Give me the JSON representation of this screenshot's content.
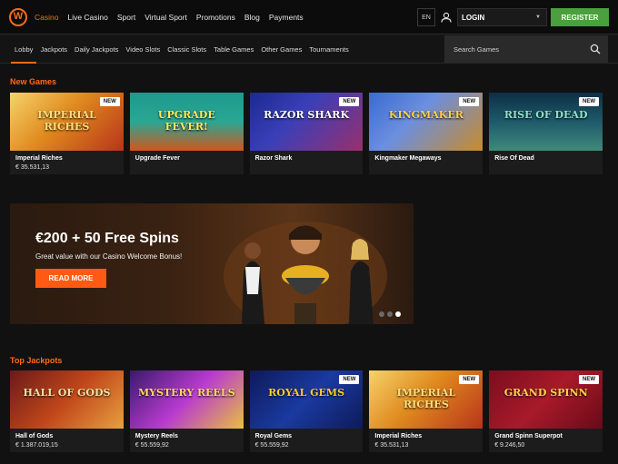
{
  "header": {
    "logo_letter": "W",
    "nav": [
      "Casino",
      "Live Casino",
      "Sport",
      "Virtual Sport",
      "Promotions",
      "Blog",
      "Payments"
    ],
    "language": "EN",
    "login_label": "LOGIN",
    "register_label": "REGISTER"
  },
  "subnav": {
    "items": [
      "Lobby",
      "Jackpots",
      "Daily Jackpots",
      "Video Slots",
      "Classic Slots",
      "Table Games",
      "Other Games",
      "Tournaments"
    ],
    "search_placeholder": "Search Games"
  },
  "new_games": {
    "title": "New Games",
    "tiles": [
      {
        "name": "Imperial Riches",
        "jackpot": "€ 35.531,13",
        "badge": "NEW",
        "art": "IMPERIAL RICHES"
      },
      {
        "name": "Upgrade Fever",
        "badge": "",
        "art": "UPGRADE FEVER!"
      },
      {
        "name": "Razor Shark",
        "badge": "NEW",
        "art": "RAZOR SHARK"
      },
      {
        "name": "Kingmaker Megaways",
        "badge": "NEW",
        "art": "KINGMAKER"
      },
      {
        "name": "Rise Of Dead",
        "badge": "NEW",
        "art": "RISE OF DEAD"
      }
    ]
  },
  "banner": {
    "headline": "€200 + 50 Free Spins",
    "subtext": "Great value with our Casino Welcome Bonus!",
    "cta_label": "READ MORE"
  },
  "top_jackpots": {
    "title": "Top Jackpots",
    "tiles": [
      {
        "name": "Hall of Gods",
        "jackpot": "€ 1.387.019,15",
        "badge": "",
        "art": "HALL OF GODS"
      },
      {
        "name": "Mystery Reels",
        "jackpot": "€ 55.559,92",
        "badge": "",
        "art": "MYSTERY REELS"
      },
      {
        "name": "Royal Gems",
        "jackpot": "€ 55.559,92",
        "badge": "NEW",
        "art": "ROYAL GEMS"
      },
      {
        "name": "Imperial Riches",
        "jackpot": "€ 35.531,13",
        "badge": "NEW",
        "art": "IMPERIAL RICHES"
      },
      {
        "name": "Grand Spinn Superpot",
        "jackpot": "€ 9.246,50",
        "badge": "NEW",
        "art": "GRAND SPINN"
      }
    ]
  },
  "colors": {
    "accent": "#ff6a1a",
    "register": "#4aa03c",
    "cta": "#ff5a14"
  }
}
